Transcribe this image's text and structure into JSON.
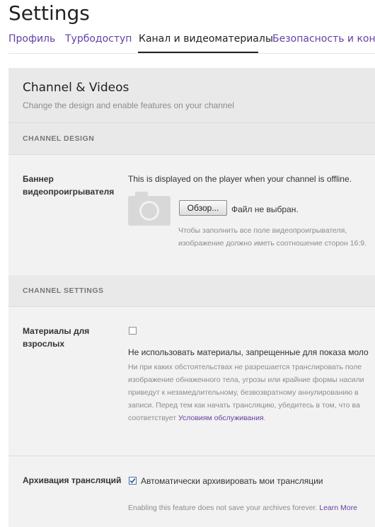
{
  "page": {
    "title": "Settings"
  },
  "tabs": [
    {
      "label": "Профиль"
    },
    {
      "label": "Турбодоступ"
    },
    {
      "label": "Канал и видеоматериалы"
    },
    {
      "label": "Безопасность и конфи"
    }
  ],
  "card": {
    "title": "Channel & Videos",
    "subtitle": "Change the design and enable features on your channel"
  },
  "channel_design": {
    "label": "CHANNEL DESIGN",
    "banner": {
      "label": "Баннер видеопроигрывателя",
      "description": "This is displayed on the player when your channel is offline.",
      "browse_label": "Обзор...",
      "file_status": "Файл не выбран.",
      "hint_line1": "Чтобы заполнить все поле видеопроигрывателя,",
      "hint_line2": "изображение должно иметь соотношение сторон 16:9."
    }
  },
  "channel_settings": {
    "label": "CHANNEL SETTINGS",
    "mature": {
      "label": "Материалы для взрослых",
      "checked": false,
      "title": "Не использовать материалы, запрещенные для показа моло",
      "hint_lines": [
        "Ни при каких обстоятельствах не разрешается транслировать поле",
        "изображение обнаженного тела, угрозы или крайние формы насили",
        "приведут к незамедлительному, безвозвратному аннулированию в",
        "записи. Перед тем как начать трансляцию, убедитесь в том, что ва"
      ],
      "hint_last_prefix": "соответствует ",
      "hint_link": "Условиям обслуживания",
      "hint_last_suffix": "."
    },
    "archive": {
      "label": "Архивация трансляций",
      "checked": true,
      "option_label": "Автоматически архивировать мои трансляции",
      "hint": "Enabling this feature does not save your archives forever.",
      "learn_more": "Learn More"
    }
  },
  "colors": {
    "accent": "#6441a5",
    "panel_bg": "#f2f2f2",
    "section_bg": "#e9e9e9"
  }
}
